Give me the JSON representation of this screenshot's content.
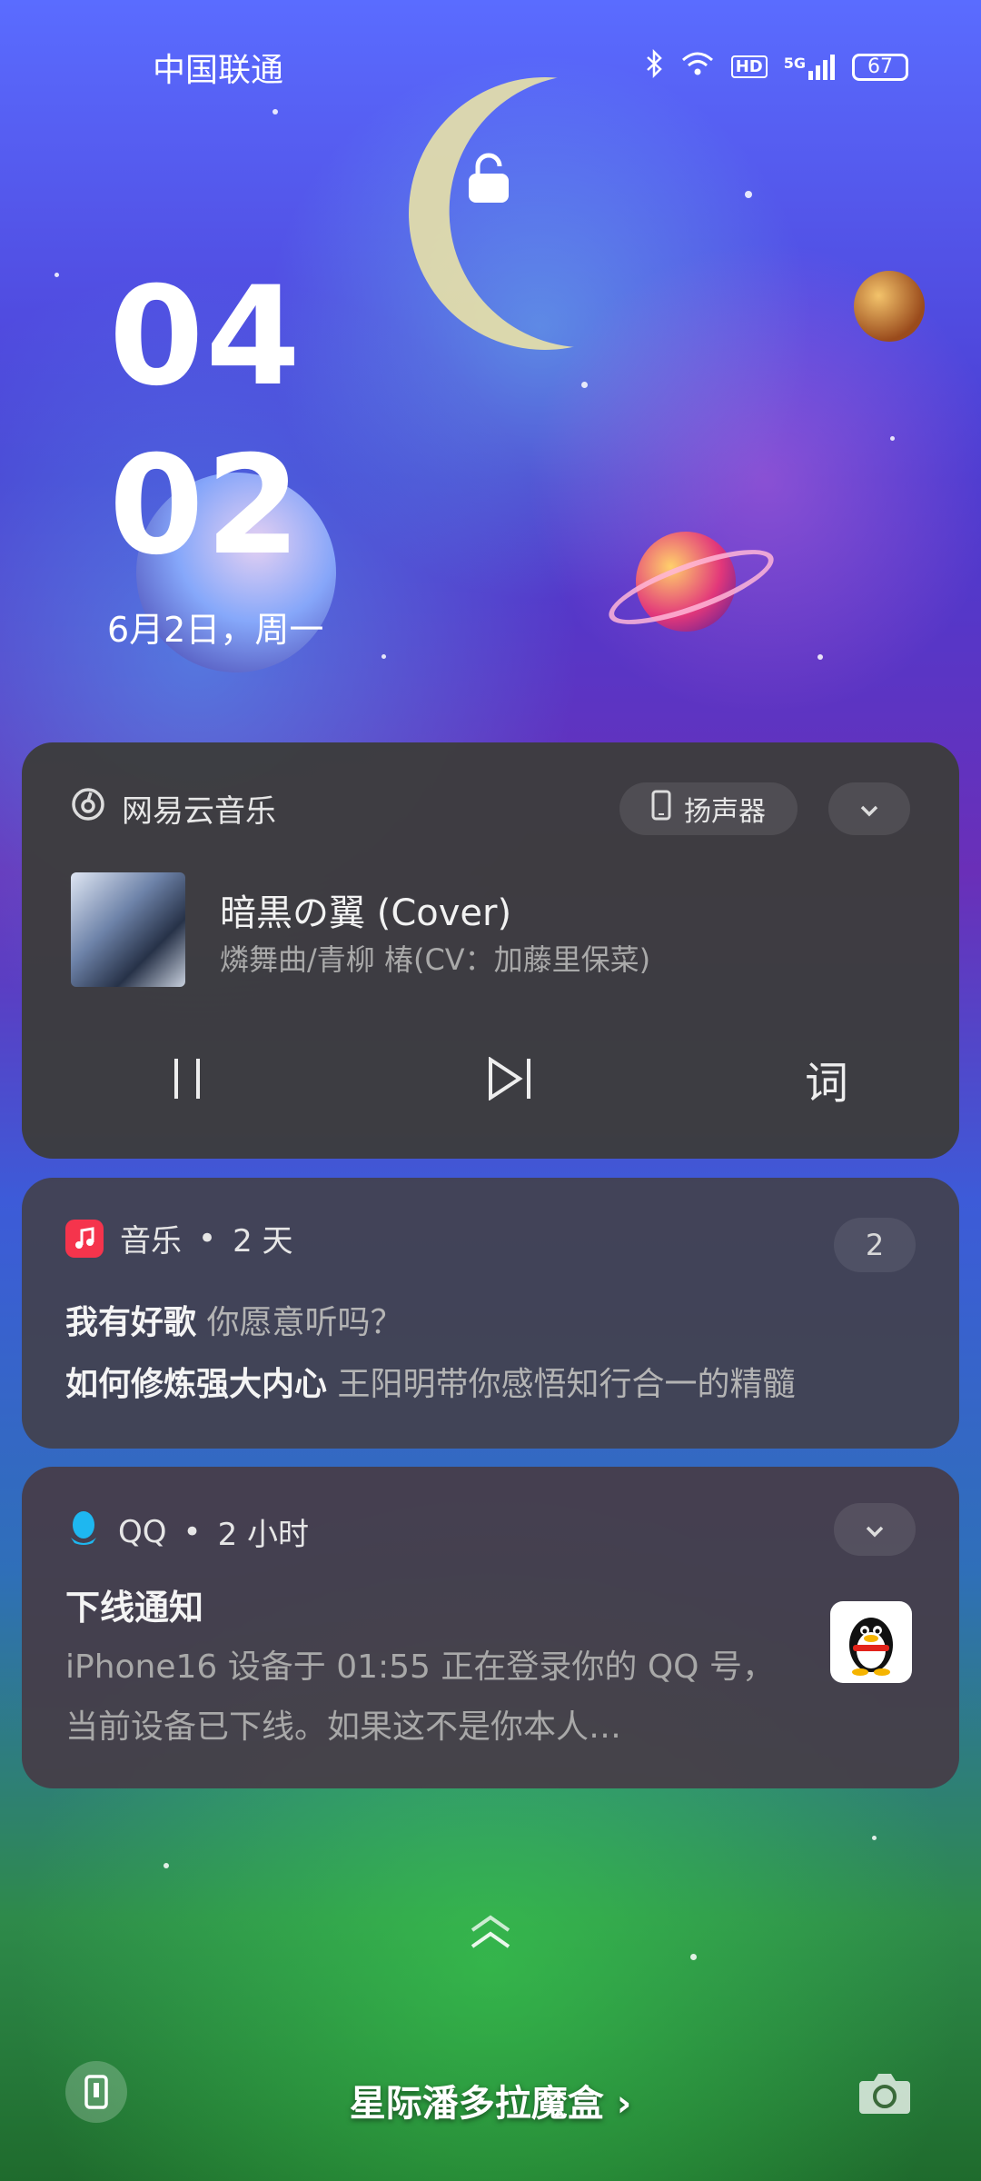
{
  "status_bar": {
    "carrier": "中国联通",
    "battery": "67",
    "icons": [
      "bluetooth-icon",
      "wifi-icon",
      "hd-icon",
      "signal-5g-icon",
      "battery-icon"
    ],
    "hd_label": "HD",
    "network_label": "5G"
  },
  "lock_screen": {
    "time_hour": "04",
    "time_minute": "02",
    "date": "6月2日，周一"
  },
  "media_card": {
    "app_name": "网易云音乐",
    "output_device": "扬声器",
    "song_title": "暗黒の翼 (Cover)",
    "artist": "燐舞曲/青柳 椿(CV：加藤里保菜)",
    "lyrics_label": "词"
  },
  "music_card": {
    "app_name": "音乐",
    "time_ago": "2 天",
    "count": "2",
    "lines": [
      {
        "bold": "我有好歌",
        "rest": "你愿意听吗？"
      },
      {
        "bold": "如何修炼强大内心",
        "rest": "王阳明带你感悟知行合一的精髓"
      }
    ]
  },
  "qq_card": {
    "app_name": "QQ",
    "time_ago": "2 小时",
    "title": "下线通知",
    "body": "iPhone16 设备于 01:55 正在登录你的 QQ 号，当前设备已下线。如果这不是你本人…"
  },
  "bottom": {
    "title": "星际潘多拉魔盒 ›"
  },
  "colors": {
    "card_bg": "#3e3e40",
    "music_icon": "#f5344c",
    "qq_icon": "#1eb7f0"
  }
}
